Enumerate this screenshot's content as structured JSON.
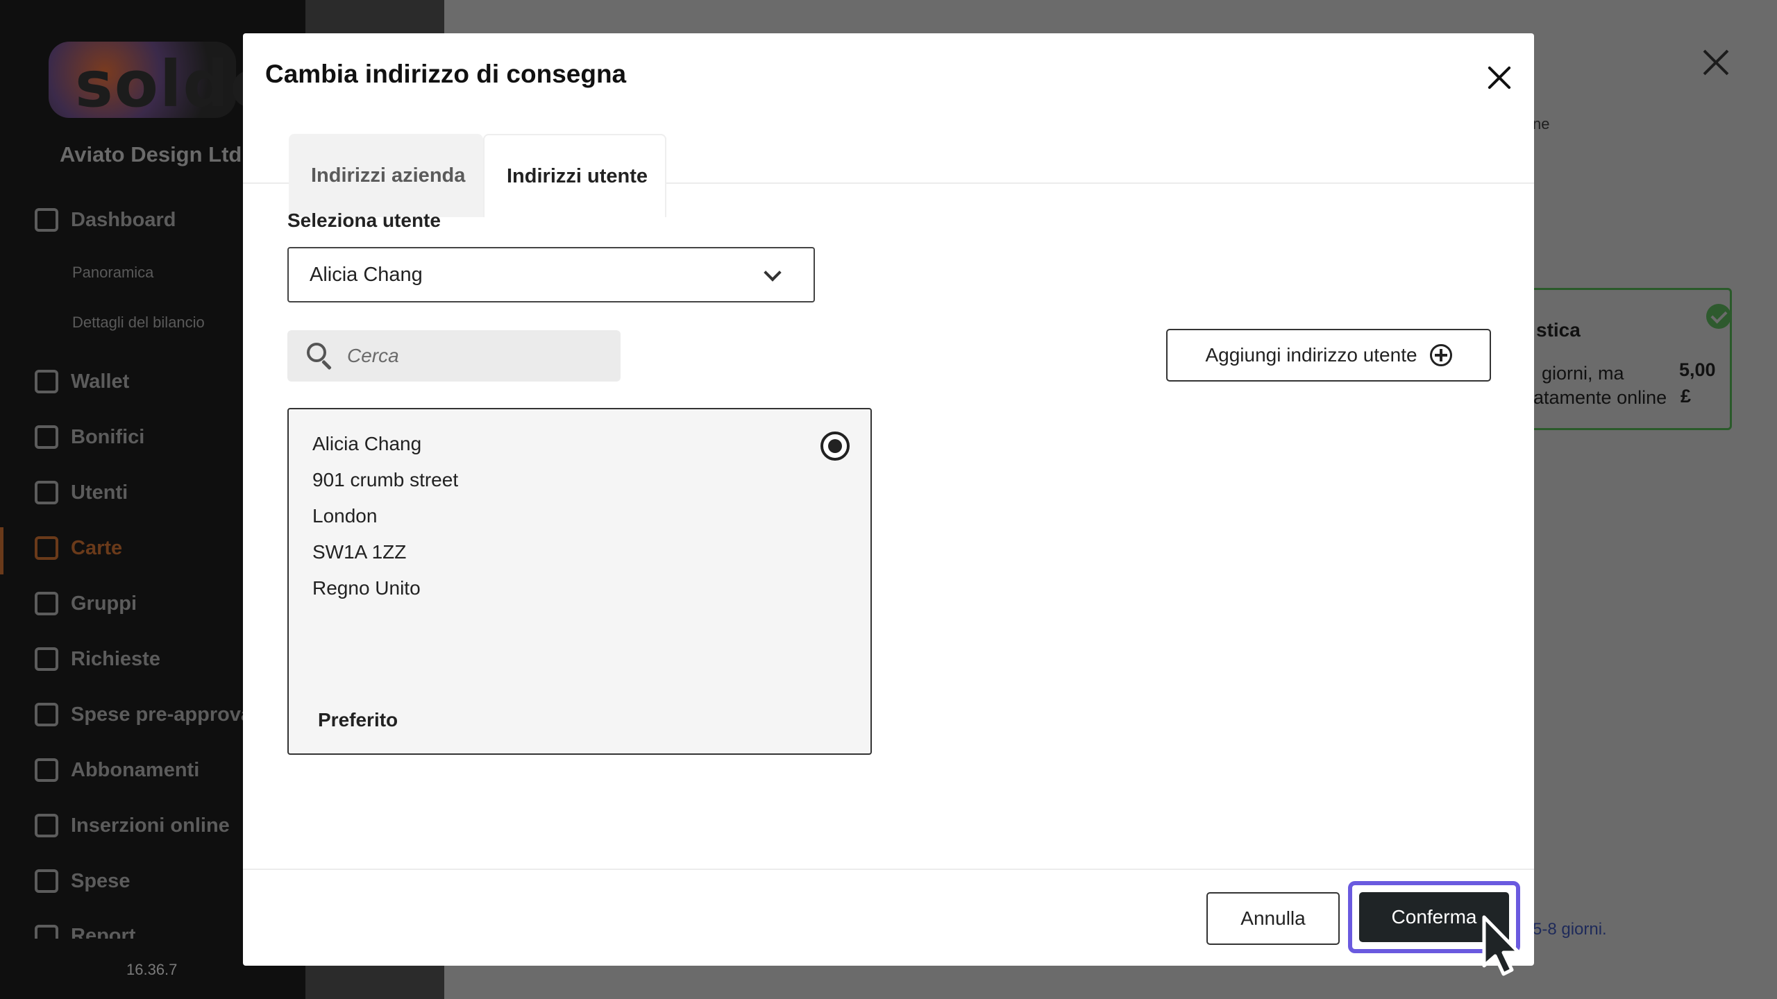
{
  "background": {
    "brand": "soldo",
    "company": "Aviato Design Ltd",
    "nav": [
      {
        "label": "Dashboard",
        "icon": "home-icon"
      },
      {
        "label": "Panoramica",
        "sub": true
      },
      {
        "label": "Dettagli del bilancio",
        "sub": true
      },
      {
        "label": "Wallet",
        "icon": "wallet-icon"
      },
      {
        "label": "Bonifici",
        "icon": "bank-icon"
      },
      {
        "label": "Utenti",
        "icon": "user-icon"
      },
      {
        "label": "Carte",
        "icon": "card-icon",
        "active": true
      },
      {
        "label": "Gruppi",
        "icon": "groups-icon"
      },
      {
        "label": "Richieste",
        "icon": "requests-icon"
      },
      {
        "label": "Spese pre-approva",
        "icon": "preapproved-icon"
      },
      {
        "label": "Abbonamenti",
        "icon": "clock-icon"
      },
      {
        "label": "Inserzioni online",
        "icon": "megaphone-icon"
      },
      {
        "label": "Spese",
        "icon": "check-icon"
      },
      {
        "label": "Report",
        "icon": "chart-icon"
      }
    ],
    "version": "16.36.7",
    "right_text": "ne",
    "card_title": "stica",
    "card_line1": "giorni, ma",
    "card_line2": "iatamente online",
    "card_price": "5,00",
    "card_currency": "£",
    "days_text": "5-8 giorni."
  },
  "modal": {
    "title": "Cambia indirizzo di consegna",
    "tabs": [
      {
        "label": "Indirizzi azienda",
        "active": false
      },
      {
        "label": "Indirizzi utente",
        "active": true
      }
    ],
    "select_label": "Seleziona utente",
    "select_value": "Alicia Chang",
    "search_placeholder": "Cerca",
    "add_button": "Aggiungi indirizzo utente",
    "address": {
      "name": "Alicia Chang",
      "street": "901 crumb street",
      "city": "London",
      "postcode": "SW1A 1ZZ",
      "country": "Regno Unito",
      "tag": "Preferito",
      "selected": true
    },
    "cancel": "Annulla",
    "confirm": "Conferma"
  },
  "colors": {
    "focus_ring": "#6a5adf",
    "primary_button": "#1f2426",
    "active_nav": "#e07020"
  }
}
